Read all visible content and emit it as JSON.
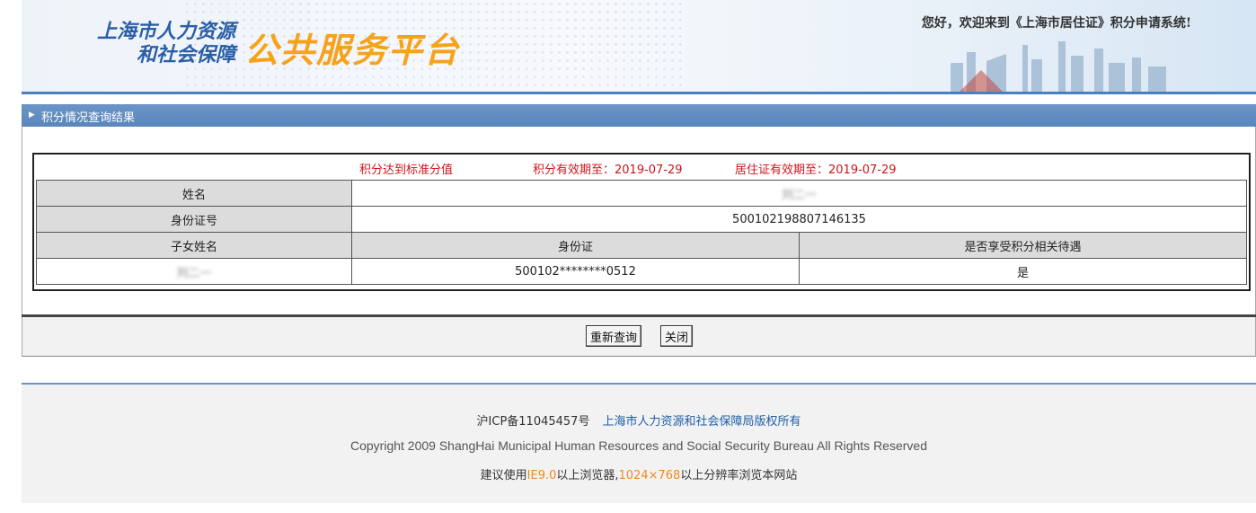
{
  "header": {
    "logo_line1": "上海市人力资源",
    "logo_line2": "和社会保障",
    "logo_big": "公共服务平台",
    "welcome": "您好，欢迎来到《上海市居住证》积分申请系统!"
  },
  "panel": {
    "title": "积分情况查询结果"
  },
  "status": {
    "standard": "积分达到标准分值",
    "score_valid": "积分有效期至：2019-07-29",
    "permit_valid": "居住证有效期至：2019-07-29"
  },
  "table": {
    "name_label": "姓名",
    "name_value": "刘二一",
    "id_label": "身份证号",
    "id_value": "500102198807146135",
    "child_headers": [
      "子女姓名",
      "身份证",
      "是否享受积分相关待遇"
    ],
    "child_rows": [
      {
        "name": "刘二一",
        "id": "500102********0512",
        "benefit": "是"
      }
    ]
  },
  "buttons": {
    "requery": "重新查询",
    "close": "关闭"
  },
  "footer": {
    "icp": "沪ICP备11045457号",
    "owner": "上海市人力资源和社会保障局版权所有",
    "copyright": "Copyright 2009 ShangHai Municipal Human Resources and Social Security Bureau All Rights Reserved",
    "advice_prefix": "建议使用",
    "browser": "IE9.0",
    "advice_mid": "以上浏览器,",
    "resolution": "1024×768",
    "advice_suffix": "以上分辨率浏览本网站"
  },
  "colors": {
    "accent_blue": "#4a7fc0",
    "logo_orange": "#f7a21b",
    "status_red": "#d0131b"
  }
}
